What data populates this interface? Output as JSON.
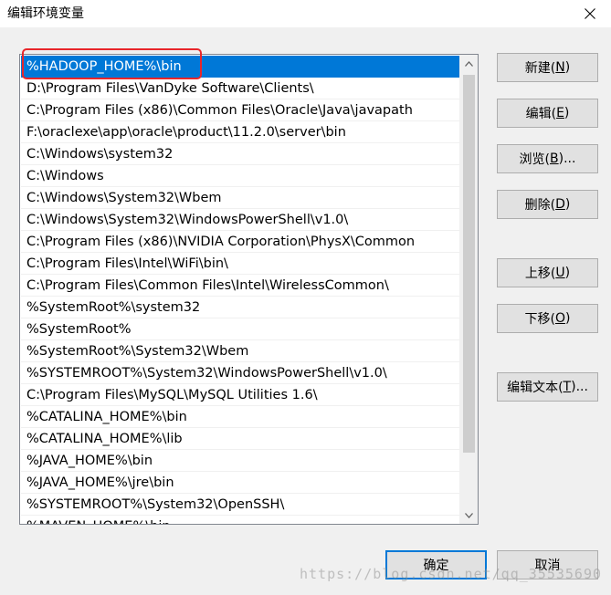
{
  "window": {
    "title": "编辑环境变量"
  },
  "list": {
    "items": [
      "%HADOOP_HOME%\\bin",
      "D:\\Program Files\\VanDyke Software\\Clients\\",
      "C:\\Program Files (x86)\\Common Files\\Oracle\\Java\\javapath",
      "F:\\oraclexe\\app\\oracle\\product\\11.2.0\\server\\bin",
      "C:\\Windows\\system32",
      "C:\\Windows",
      "C:\\Windows\\System32\\Wbem",
      "C:\\Windows\\System32\\WindowsPowerShell\\v1.0\\",
      "C:\\Program Files (x86)\\NVIDIA Corporation\\PhysX\\Common",
      "C:\\Program Files\\Intel\\WiFi\\bin\\",
      "C:\\Program Files\\Common Files\\Intel\\WirelessCommon\\",
      "%SystemRoot%\\system32",
      "%SystemRoot%",
      "%SystemRoot%\\System32\\Wbem",
      "%SYSTEMROOT%\\System32\\WindowsPowerShell\\v1.0\\",
      "C:\\Program Files\\MySQL\\MySQL Utilities 1.6\\",
      "%CATALINA_HOME%\\bin",
      "%CATALINA_HOME%\\lib",
      "%JAVA_HOME%\\bin",
      "%JAVA_HOME%\\jre\\bin",
      "%SYSTEMROOT%\\System32\\OpenSSH\\",
      "%MAVEN_HOME%\\bin"
    ],
    "selected_index": 0
  },
  "buttons": {
    "new": {
      "label": "新建(",
      "key": "N",
      "end": ")"
    },
    "edit": {
      "label": "编辑(",
      "key": "E",
      "end": ")"
    },
    "browse": {
      "label": "浏览(",
      "key": "B",
      "end": ")..."
    },
    "delete": {
      "label": "删除(",
      "key": "D",
      "end": ")"
    },
    "move_up": {
      "label": "上移(",
      "key": "U",
      "end": ")"
    },
    "move_down": {
      "label": "下移(",
      "key": "O",
      "end": ")"
    },
    "edit_text": {
      "label": "编辑文本(",
      "key": "T",
      "end": ")..."
    },
    "ok": "确定",
    "cancel": "取消"
  },
  "watermark": "https://blog.csdn.net/qq_35535690",
  "colors": {
    "selection": "#0078d7",
    "highlight_box": "#e8262b",
    "dialog_bg": "#f0f0f0"
  }
}
